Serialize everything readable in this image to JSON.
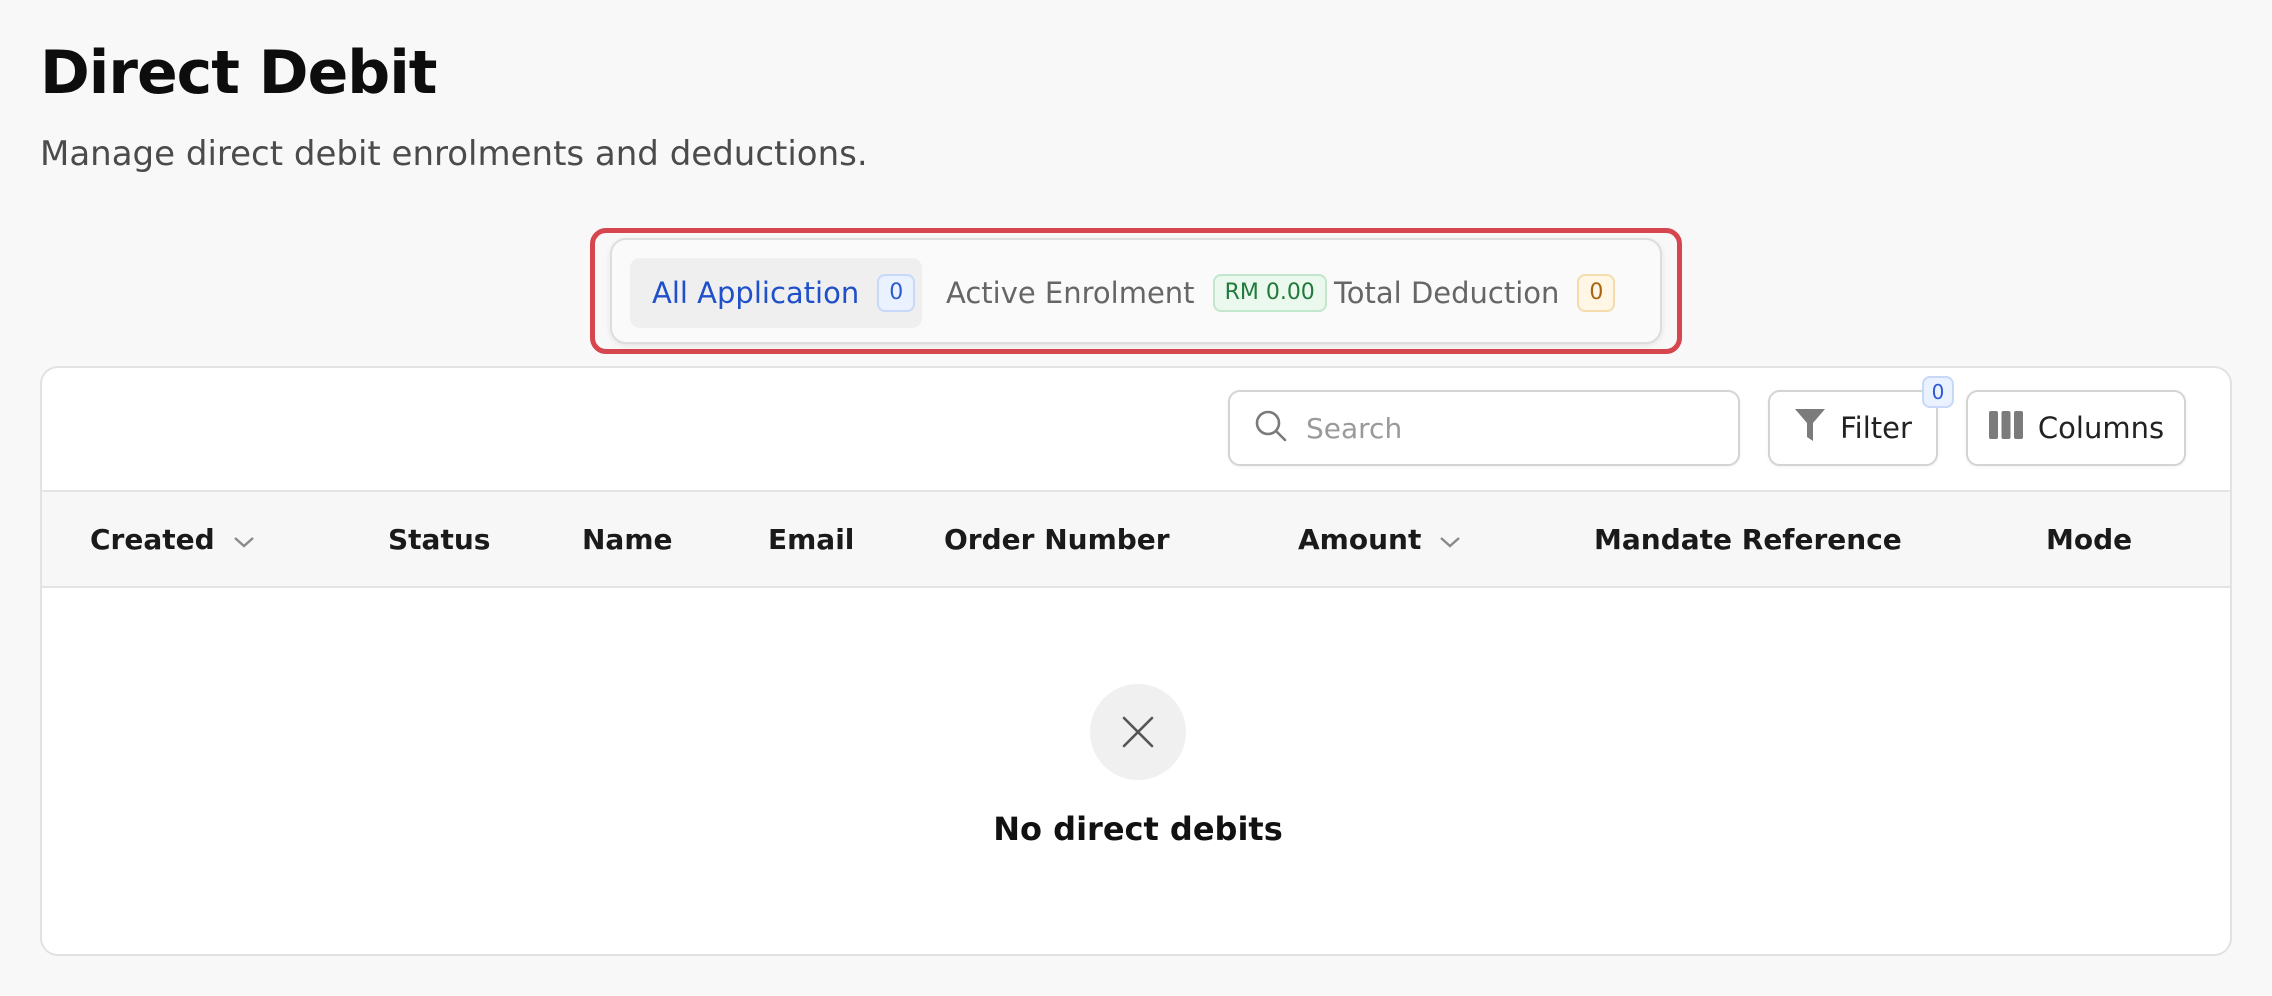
{
  "header": {
    "title": "Direct Debit",
    "subtitle": "Manage direct debit enrolments and deductions."
  },
  "tabs": [
    {
      "label": "All Application",
      "badge": "0",
      "active": true
    },
    {
      "label": "Active Enrolment",
      "badge": "RM 0.00",
      "active": false
    },
    {
      "label": "Total Deduction",
      "badge": "0",
      "active": false
    }
  ],
  "toolbar": {
    "search_placeholder": "Search",
    "search_value": "",
    "filter_label": "Filter",
    "filter_count": "0",
    "columns_label": "Columns"
  },
  "table": {
    "columns": [
      {
        "label": "Created",
        "sortable": true
      },
      {
        "label": "Status",
        "sortable": false
      },
      {
        "label": "Name",
        "sortable": false
      },
      {
        "label": "Email",
        "sortable": false
      },
      {
        "label": "Order Number",
        "sortable": false
      },
      {
        "label": "Amount",
        "sortable": true
      },
      {
        "label": "Mandate Reference",
        "sortable": false
      },
      {
        "label": "Mode",
        "sortable": false
      }
    ],
    "rows": [],
    "empty_message": "No direct debits"
  },
  "icons": {
    "search": "search-icon",
    "filter": "filter-icon",
    "columns": "columns-icon",
    "sort": "chevron-down-icon",
    "empty": "close-icon"
  },
  "colors": {
    "accent": "#1f4fc9",
    "highlight": "#d6464f",
    "badge_blue": "#2d5bd0",
    "badge_green": "#217a3b",
    "badge_amber": "#a8650b"
  }
}
